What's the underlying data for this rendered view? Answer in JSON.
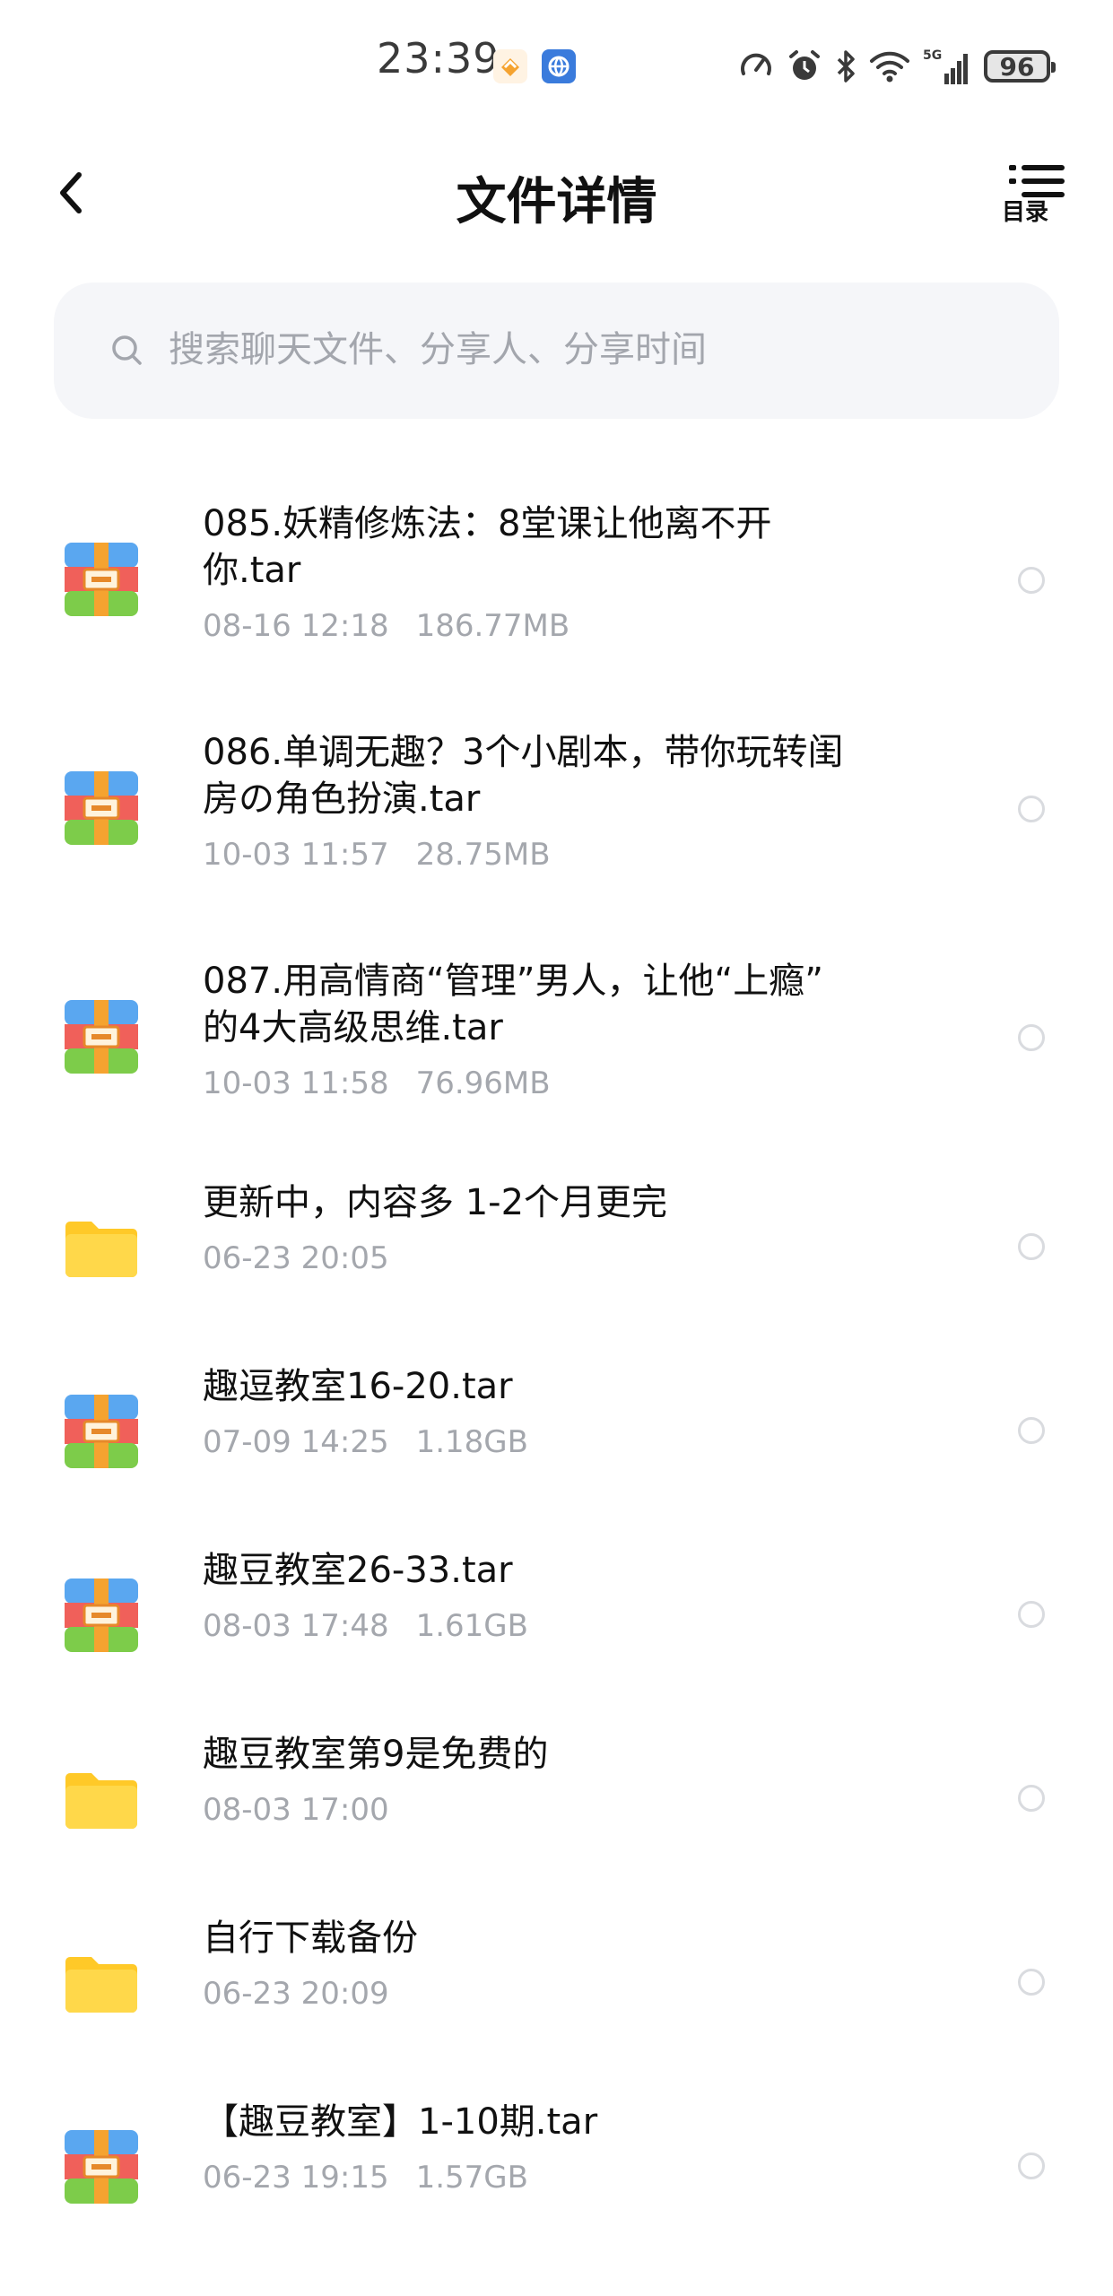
{
  "status_bar": {
    "time": "23:39",
    "battery": "96",
    "network": "5G"
  },
  "header": {
    "title": "文件详情",
    "toc_label": "目录"
  },
  "search": {
    "placeholder": "搜索聊天文件、分享人、分享时间"
  },
  "colors": {
    "archive_blue": "#5aa7f0",
    "archive_red": "#f0605a",
    "archive_green": "#7dcc4a",
    "archive_orange": "#f5a330",
    "folder_yellow": "#ffd23f",
    "meta_gray": "#a4a7ad"
  },
  "files": [
    {
      "type": "archive",
      "name_line1": "085.妖精修炼法：8堂课让他离不开",
      "name_line2": "你.tar",
      "date": "08-16  12:18",
      "size": "186.77MB"
    },
    {
      "type": "archive",
      "name_line1": "086.单调无趣？3个小剧本，带你玩转闺",
      "name_line2": "房の角色扮演.tar",
      "date": "10-03  11:57",
      "size": "28.75MB"
    },
    {
      "type": "archive",
      "name_line1": "087.用高情商“管理”男人，让他“上瘾”",
      "name_line2": "的4大高级思维.tar",
      "date": "10-03  11:58",
      "size": "76.96MB"
    },
    {
      "type": "folder",
      "name_line1": "更新中，内容多 1-2个月更完",
      "name_line2": "",
      "date": "06-23  20:05",
      "size": ""
    },
    {
      "type": "archive",
      "name_line1": "趣逗教室16-20.tar",
      "name_line2": "",
      "date": "07-09  14:25",
      "size": "1.18GB"
    },
    {
      "type": "archive",
      "name_line1": "趣豆教室26-33.tar",
      "name_line2": "",
      "date": "08-03  17:48",
      "size": "1.61GB"
    },
    {
      "type": "folder",
      "name_line1": "趣豆教室第9是免费的",
      "name_line2": "",
      "date": "08-03  17:00",
      "size": ""
    },
    {
      "type": "folder",
      "name_line1": "自行下载备份",
      "name_line2": "",
      "date": "06-23  20:09",
      "size": ""
    },
    {
      "type": "archive",
      "name_line1": "【趣豆教室】1-10期.tar",
      "name_line2": "",
      "date": "06-23  19:15",
      "size": "1.57GB"
    }
  ]
}
